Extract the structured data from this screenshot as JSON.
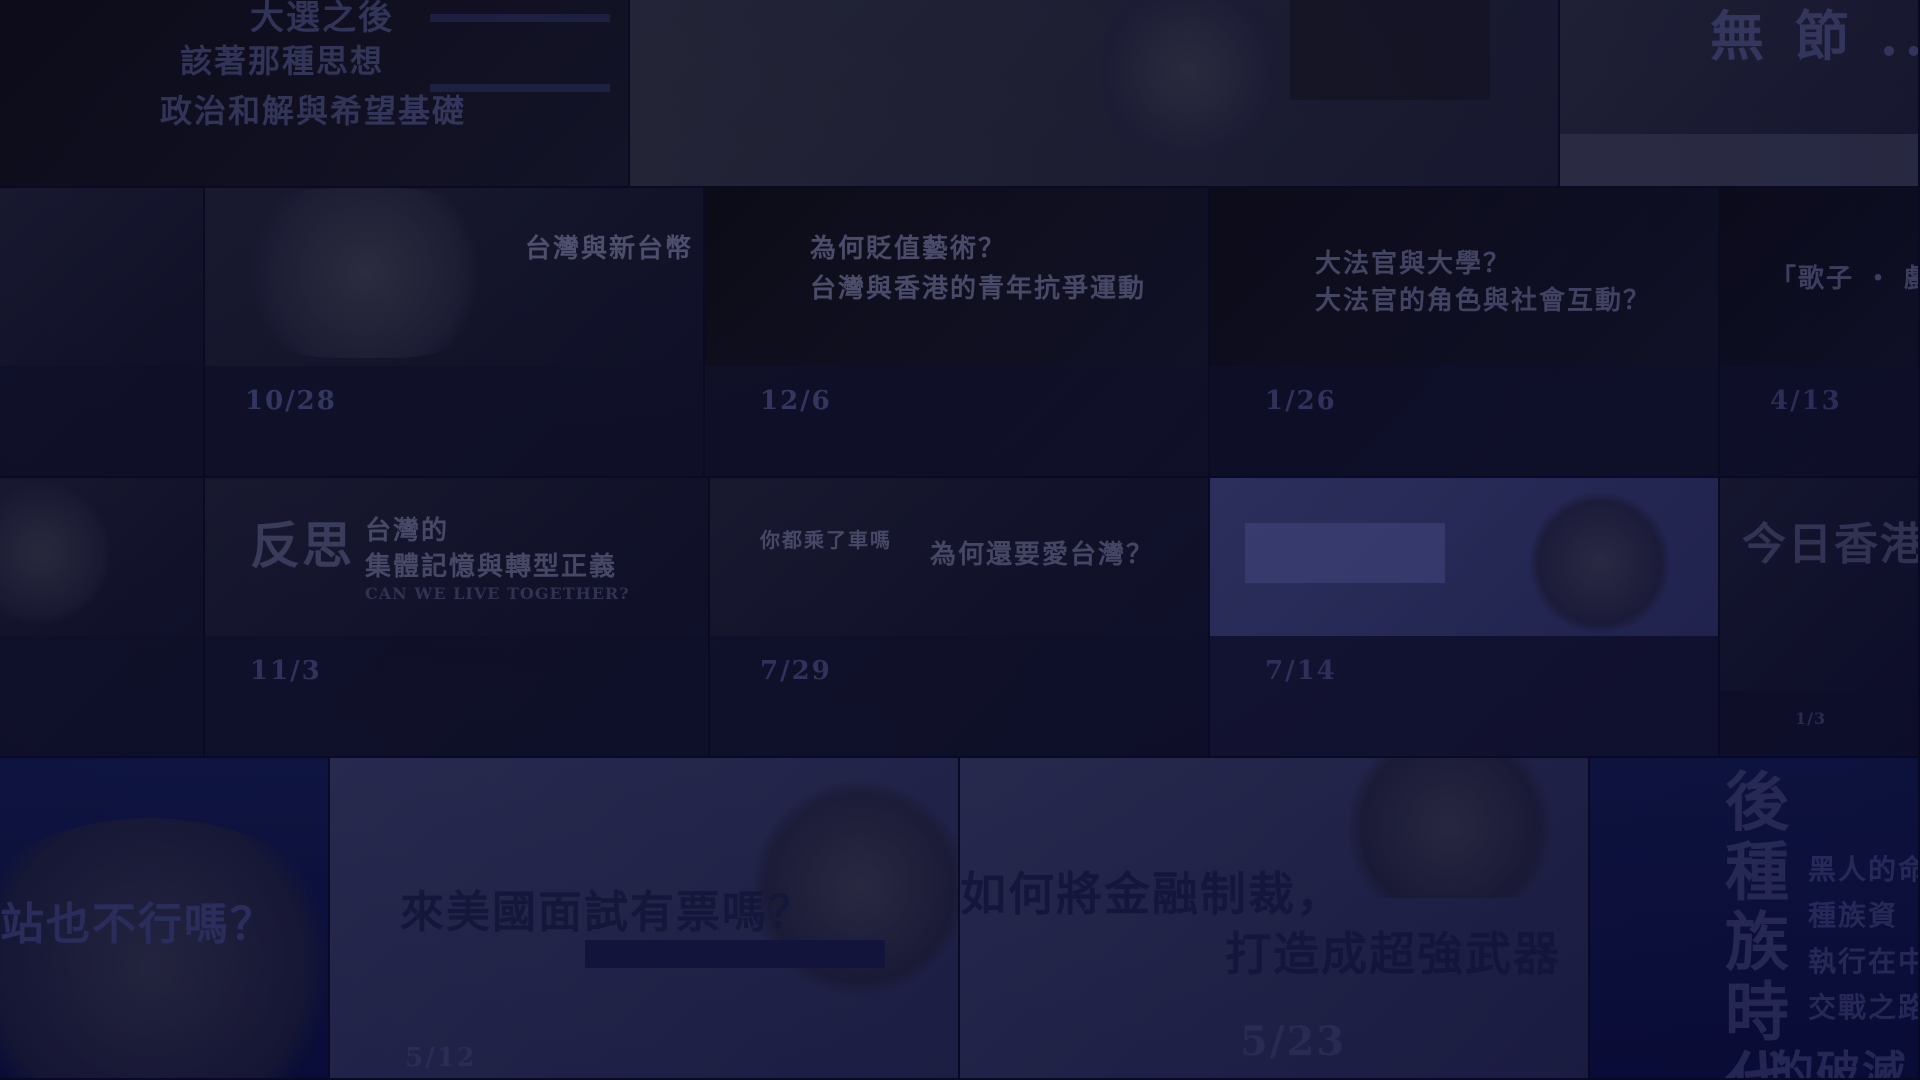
{
  "backdrop": {
    "row1": {
      "poster_a_lines": [
        "大選之後",
        "該著那種思想",
        "政治和解與希望基礎"
      ],
      "poster_d_title": "無 節 ..."
    },
    "row2": {
      "poster_b": "台灣與新台幣",
      "poster_c_lines": [
        "為何貶值藝術？",
        "台灣與香港的青年抗爭運動"
      ],
      "poster_d_lines": [
        "大法官與大學？",
        "大法官的角色與社會互動？"
      ],
      "poster_e": "「歌子 ・ 戲」",
      "dates": [
        "10/28",
        "12/6",
        "1/26",
        "4/13"
      ]
    },
    "row3": {
      "poster_b_big": "反思",
      "poster_b_lines": [
        "台灣的",
        "集體記憶與轉型正義",
        "CAN WE LIVE TOGETHER?"
      ],
      "poster_c_lines": [
        "你都乘了車嗎",
        "為何還要愛台灣？"
      ],
      "poster_e": "今日香港",
      "dates": [
        "11/3",
        "7/29",
        "7/14",
        "1/3"
      ]
    },
    "row4": {
      "poster_a": "站也不行嗎？",
      "poster_b": "來美國面試有票嗎？",
      "poster_c_lines": [
        "如何將金融制裁，",
        "打造成超強武器"
      ],
      "poster_d_vert": "後種族時代",
      "poster_d_lines": [
        "黑人的命",
        "種族資",
        "執行在中",
        "交戰之路"
      ],
      "poster_d_bottom": "的破滅",
      "dates": [
        "5/12",
        "5/23"
      ]
    }
  },
  "colors": {
    "base": "#07082a",
    "tint": "#10123e"
  }
}
